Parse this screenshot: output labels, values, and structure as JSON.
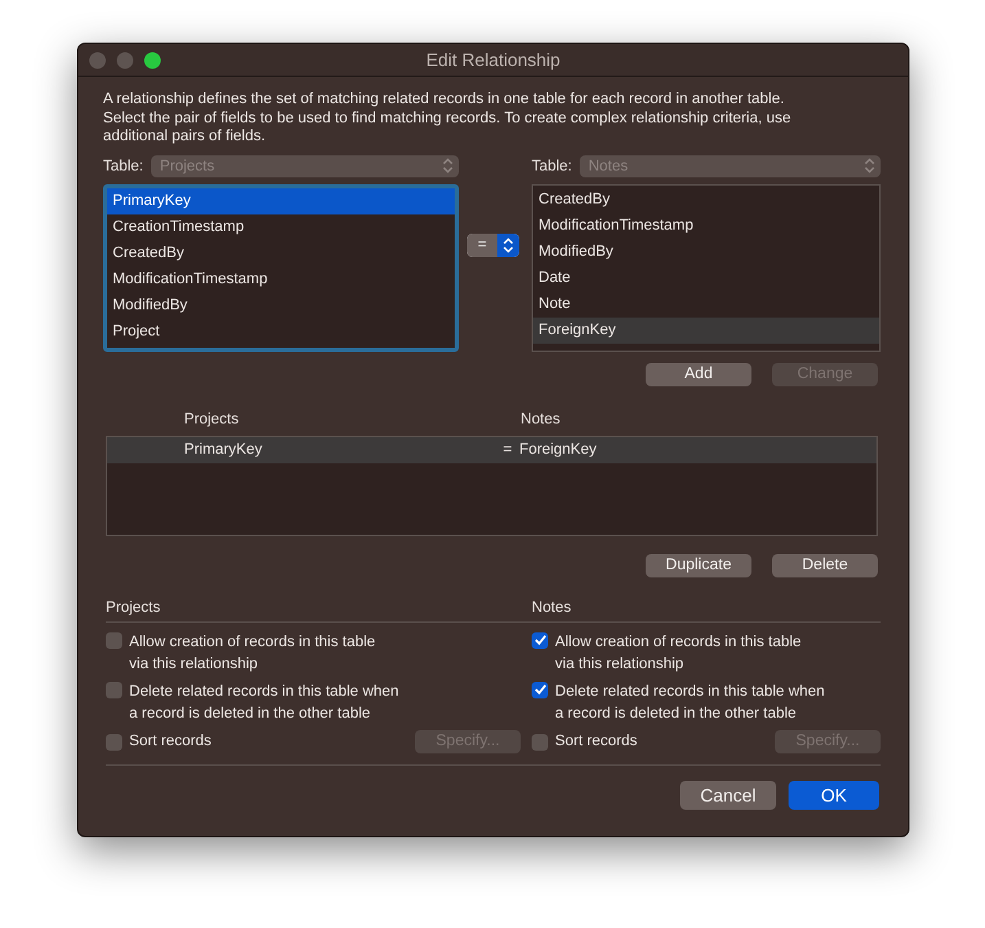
{
  "window": {
    "title": "Edit Relationship"
  },
  "description": "A relationship defines the set of matching related records in one table for each record in another table. Select the pair of fields to be used to find matching records. To create complex relationship criteria, use additional pairs of fields.",
  "left": {
    "table_label": "Table:",
    "table": "Projects",
    "table_disabled": true,
    "focused": true,
    "fields": [
      {
        "label": "PrimaryKey",
        "selected": true
      },
      {
        "label": "CreationTimestamp",
        "selected": false
      },
      {
        "label": "CreatedBy",
        "selected": false
      },
      {
        "label": "ModificationTimestamp",
        "selected": false
      },
      {
        "label": "ModifiedBy",
        "selected": false
      },
      {
        "label": "Project",
        "selected": false
      }
    ]
  },
  "operator": "=",
  "right": {
    "table_label": "Table:",
    "table": "Notes",
    "table_disabled": true,
    "focused": false,
    "fields": [
      {
        "label": "CreatedBy",
        "selected": false
      },
      {
        "label": "ModificationTimestamp",
        "selected": false
      },
      {
        "label": "ModifiedBy",
        "selected": false
      },
      {
        "label": "Date",
        "selected": false
      },
      {
        "label": "Note",
        "selected": false
      },
      {
        "label": "ForeignKey",
        "selected": true
      }
    ]
  },
  "pair_buttons": [
    {
      "label": "Add",
      "disabled": false
    },
    {
      "label": "Change",
      "disabled": true
    }
  ],
  "criteria": {
    "columns": [
      "Projects",
      "Notes"
    ],
    "rows": [
      {
        "left": "PrimaryKey",
        "operator": "=",
        "right": "ForeignKey",
        "selected": true
      }
    ]
  },
  "criteria_buttons": [
    {
      "label": "Duplicate",
      "disabled": false
    },
    {
      "label": "Delete",
      "disabled": false
    }
  ],
  "options": [
    {
      "title": "Projects",
      "checkboxes": [
        {
          "label": "Allow creation of records in this table\nvia this relationship",
          "checked": false
        },
        {
          "label": "Delete related records in this table when\na record is deleted in the other table",
          "checked": false
        }
      ],
      "sort": {
        "label": "Sort records",
        "checked": false
      },
      "specify": {
        "label": "Specify...",
        "disabled": true
      }
    },
    {
      "title": "Notes",
      "checkboxes": [
        {
          "label": "Allow creation of records in this table\nvia this relationship",
          "checked": true
        },
        {
          "label": "Delete related records in this table when\na record is deleted in the other table",
          "checked": true
        }
      ],
      "sort": {
        "label": "Sort records",
        "checked": false
      },
      "specify": {
        "label": "Specify...",
        "disabled": true
      }
    }
  ],
  "footer_buttons": [
    {
      "label": "Cancel",
      "default": false
    },
    {
      "label": "OK",
      "default": true
    }
  ]
}
